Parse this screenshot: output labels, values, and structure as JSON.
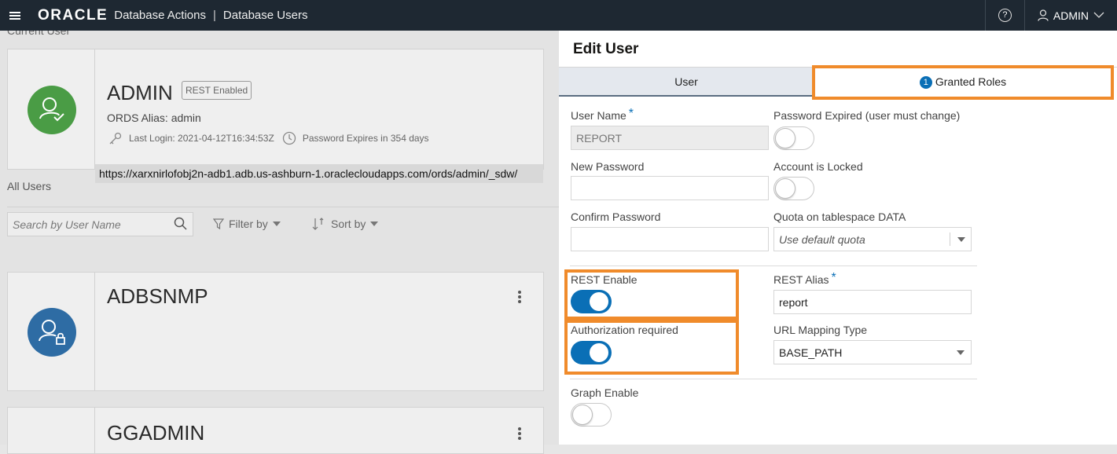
{
  "header": {
    "brand": "ORACLE",
    "app_name": "Database Actions",
    "separator": "|",
    "page_name": "Database Users",
    "help_label": "?",
    "user_label": "ADMIN"
  },
  "current_user": {
    "section_label": "Current User",
    "name": "ADMIN",
    "rest_badge": "REST Enabled",
    "ords_alias": "ORDS Alias: admin",
    "last_login": "Last Login: 2021-04-12T16:34:53Z",
    "password_expires": "Password Expires in 354 days",
    "url": "https://xarxnirlofobj2n-adb1.adb.us-ashburn-1.oraclecloudapps.com/ords/admin/_sdw/"
  },
  "all_users": {
    "section_label": "All Users",
    "search_placeholder": "Search by User Name",
    "filter_label": "Filter by",
    "sort_label": "Sort by",
    "cards": [
      {
        "name": "ADBSNMP",
        "avatar_color": "#2e6ca4"
      },
      {
        "name": "GGADMIN",
        "avatar_color": "#2e6ca4"
      }
    ]
  },
  "edit_user": {
    "title": "Edit User",
    "tabs": [
      {
        "label": "User",
        "active": true
      },
      {
        "label": "Granted Roles",
        "badge": "1",
        "active": false
      }
    ],
    "fields": {
      "user_name_label": "User Name",
      "user_name_value": "REPORT",
      "password_expired_label": "Password Expired (user must change)",
      "new_password_label": "New Password",
      "account_locked_label": "Account is Locked",
      "confirm_password_label": "Confirm Password",
      "quota_label": "Quota on tablespace DATA",
      "quota_value": "Use default quota",
      "rest_enable_label": "REST Enable",
      "rest_alias_label": "REST Alias",
      "rest_alias_value": "report",
      "auth_required_label": "Authorization required",
      "url_mapping_label": "URL Mapping Type",
      "url_mapping_value": "BASE_PATH",
      "graph_enable_label": "Graph Enable",
      "required_marker": "*"
    },
    "toggles": {
      "password_expired": false,
      "account_locked": false,
      "rest_enable": true,
      "auth_required": true,
      "graph_enable": false
    }
  },
  "colors": {
    "header_bg": "#1e2832",
    "accent": "#0a6fb6",
    "highlight": "#f08b2b",
    "admin_avatar": "#4a9c45"
  }
}
